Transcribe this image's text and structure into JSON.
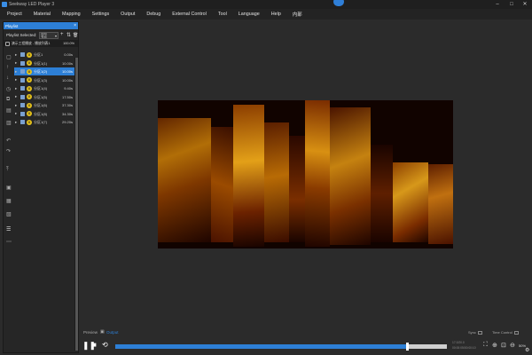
{
  "window": {
    "title": "Seekway LED Player 3"
  },
  "menu": [
    "Project",
    "Material",
    "Mapping",
    "Settings",
    "Output",
    "Debug",
    "External Control",
    "Tool",
    "Language",
    "Help",
    "内部"
  ],
  "panel": {
    "header": "Playlist",
    "selected_label": "Playlist Selected:",
    "selected_value_line1": "自动",
    "selected_value_line2": "节目",
    "playlist_name": "演示工程播放 - 播放列表1",
    "playlist_percent": "100.0%"
  },
  "programs": [
    {
      "name": "分区1",
      "duration": "0.00s",
      "selected": false
    },
    {
      "name": "分区1(1)",
      "duration": "10.00s",
      "selected": false
    },
    {
      "name": "分区1(2)",
      "duration": "10.00s",
      "selected": true
    },
    {
      "name": "分区1(3)",
      "duration": "10.00s",
      "selected": false
    },
    {
      "name": "分区1(4)",
      "duration": "9.40s",
      "selected": false
    },
    {
      "name": "分区1(5)",
      "duration": "17.50s",
      "selected": false
    },
    {
      "name": "分区1(6)",
      "duration": "37.30s",
      "selected": false
    },
    {
      "name": "分区1(8)",
      "duration": "34.30s",
      "selected": false
    },
    {
      "name": "分区1(7)",
      "duration": "29.20s",
      "selected": false
    }
  ],
  "bottom_tabs": {
    "preview": "Preview",
    "output": "Output",
    "sync": "Sync",
    "time_control": "Time Control"
  },
  "playback": {
    "progress_fraction": 0.88,
    "time_line1": "17.0/20.0",
    "time_line2": "00:00:05/00:00:10",
    "zoom": "50%"
  },
  "colors": {
    "accent": "#2d7fd6",
    "badge": "#e6c21a"
  }
}
